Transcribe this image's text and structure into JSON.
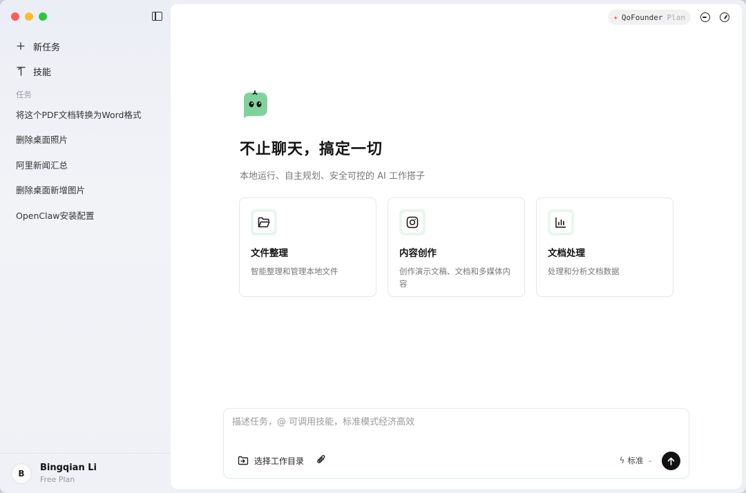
{
  "sidebar": {
    "nav": [
      {
        "icon": "plus-icon",
        "label": "新任务"
      },
      {
        "icon": "skill-icon",
        "label": "技能"
      }
    ],
    "section_label": "任务",
    "tasks": [
      "将这个PDF文档转换为Word格式",
      "删除桌面照片",
      "阿里新闻汇总",
      "删除桌面新增图片",
      "OpenClaw安装配置"
    ],
    "user": {
      "initial": "B",
      "name": "Bingqian Li",
      "plan": "Free Plan"
    }
  },
  "header": {
    "badge_name": "QoFounder",
    "badge_plan": "Plan"
  },
  "hero": {
    "headline": "不止聊天，搞定一切",
    "subline": "本地运行、自主规划、安全可控的 AI 工作搭子"
  },
  "cards": [
    {
      "icon": "folder-icon",
      "title": "文件整理",
      "desc": "智能整理和管理本地文件"
    },
    {
      "icon": "instagram-icon",
      "title": "内容创作",
      "desc": "创作演示文稿、文档和多媒体内容"
    },
    {
      "icon": "bar-chart-icon",
      "title": "文档处理",
      "desc": "处理和分析文档数据"
    }
  ],
  "composer": {
    "placeholder": "描述任务，@ 可调用技能，标准模式经济高效",
    "dir_label": "选择工作目录",
    "mode_label": "标准"
  },
  "colors": {
    "accent_green": "#7fd39a",
    "send_button": "#111111"
  }
}
